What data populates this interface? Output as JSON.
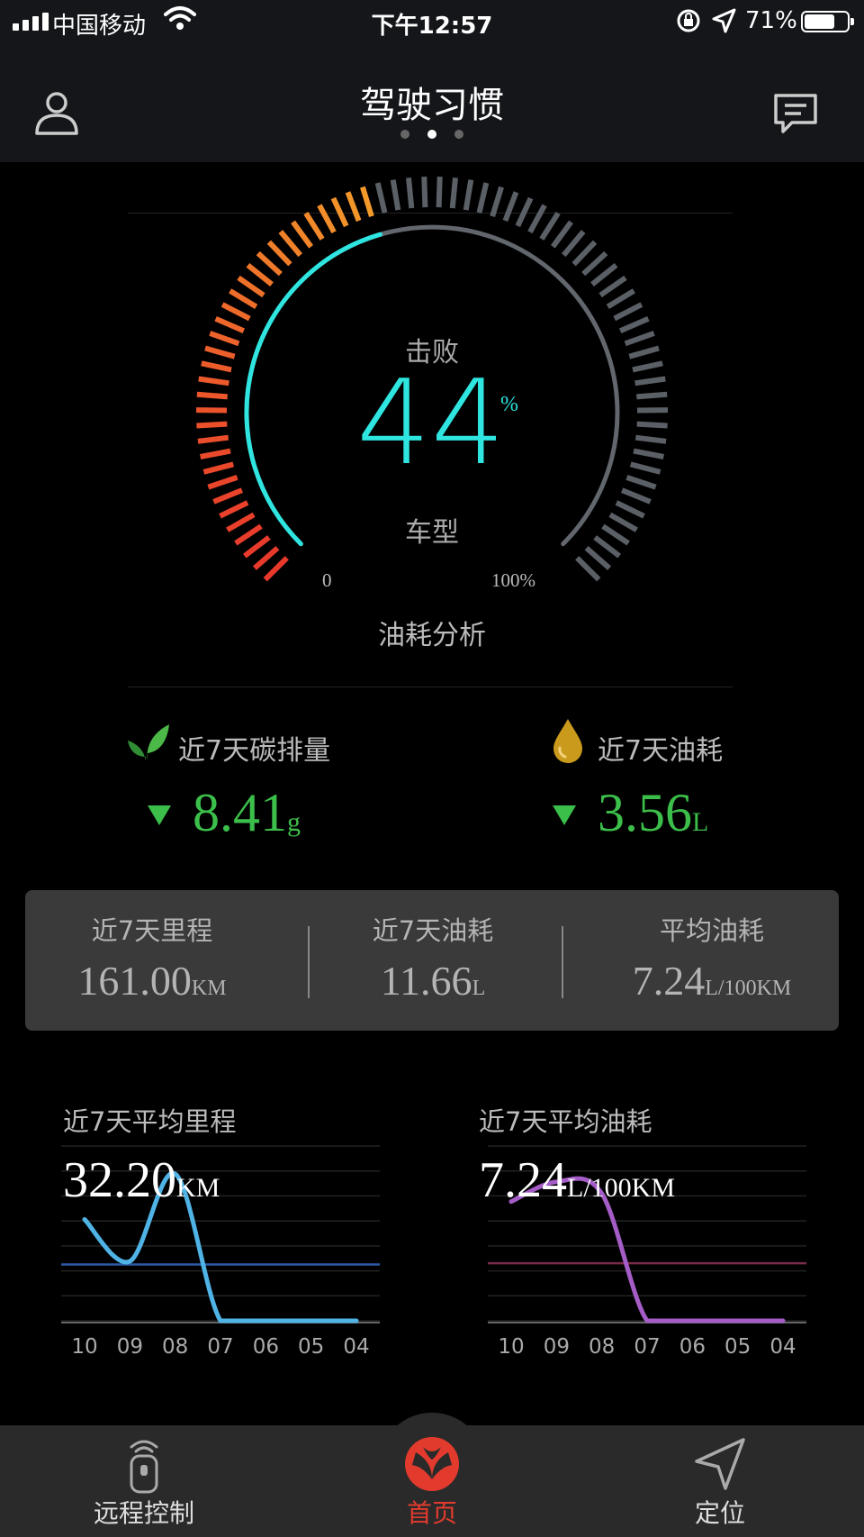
{
  "status_bar": {
    "carrier": "中国移动",
    "time": "下午12:57",
    "battery_pct": "71%",
    "battery_level": 0.71
  },
  "header": {
    "title": "驾驶习惯",
    "page_indicator": {
      "total": 3,
      "active": 1
    },
    "user_icon": "user-icon",
    "message_icon": "message-icon"
  },
  "gauge": {
    "top_label": "击败",
    "value": "44",
    "value_fraction": 0.44,
    "percent_sign": "%",
    "bottom_label": "车型",
    "min_label": "0",
    "max_label": "100%",
    "footer": "油耗分析",
    "colors": {
      "progress": "#2ee5e0",
      "ticks_red": "#e8392b",
      "ticks_orange": "#f39b2a",
      "ticks_grey": "#5b5f66"
    }
  },
  "carbon": {
    "title": "近7天碳排量",
    "value": "8.41",
    "unit": "g",
    "icon": "leaf-icon",
    "trend": "down"
  },
  "fuel7": {
    "title": "近7天油耗",
    "value": "3.56",
    "unit": "L",
    "icon": "oil-drop-icon",
    "trend": "down"
  },
  "stats": [
    {
      "label": "近7天里程",
      "value": "161.00",
      "unit": "KM"
    },
    {
      "label": "近7天油耗",
      "value": "11.66",
      "unit": "L"
    },
    {
      "label": "平均油耗",
      "value": "7.24",
      "unit": "L/100KM"
    }
  ],
  "mileage_chart": {
    "title": "近7天平均里程",
    "value": "32.20",
    "unit": "KM",
    "color": "#4fb3e6",
    "avg_color": "#2a5aa8"
  },
  "fuel_chart": {
    "title": "近7天平均油耗",
    "value": "7.24",
    "unit": "L/100KM",
    "color": "#a45cc6",
    "avg_color": "#7a2a4a"
  },
  "chart_data": [
    {
      "type": "line",
      "title": "近7天平均里程",
      "x": [
        "10",
        "09",
        "08",
        "07",
        "06",
        "05",
        "04"
      ],
      "series": [
        {
          "values": [
            58,
            34,
            84,
            0,
            0,
            0,
            0
          ]
        }
      ],
      "average": 32.2,
      "ylim": [
        0,
        100
      ],
      "grid": true
    },
    {
      "type": "line",
      "title": "近7天平均油耗",
      "x": [
        "10",
        "09",
        "08",
        "07",
        "06",
        "05",
        "04"
      ],
      "series": [
        {
          "values": [
            15,
            17.5,
            16,
            0,
            0,
            0,
            0
          ]
        }
      ],
      "average": 7.24,
      "ylim": [
        0,
        22
      ],
      "grid": true
    }
  ],
  "tabbar": [
    {
      "label": "远程控制",
      "icon": "remote-control-icon",
      "active": false
    },
    {
      "label": "首页",
      "icon": "home-logo-icon",
      "active": true
    },
    {
      "label": "定位",
      "icon": "location-arrow-icon",
      "active": false
    }
  ]
}
